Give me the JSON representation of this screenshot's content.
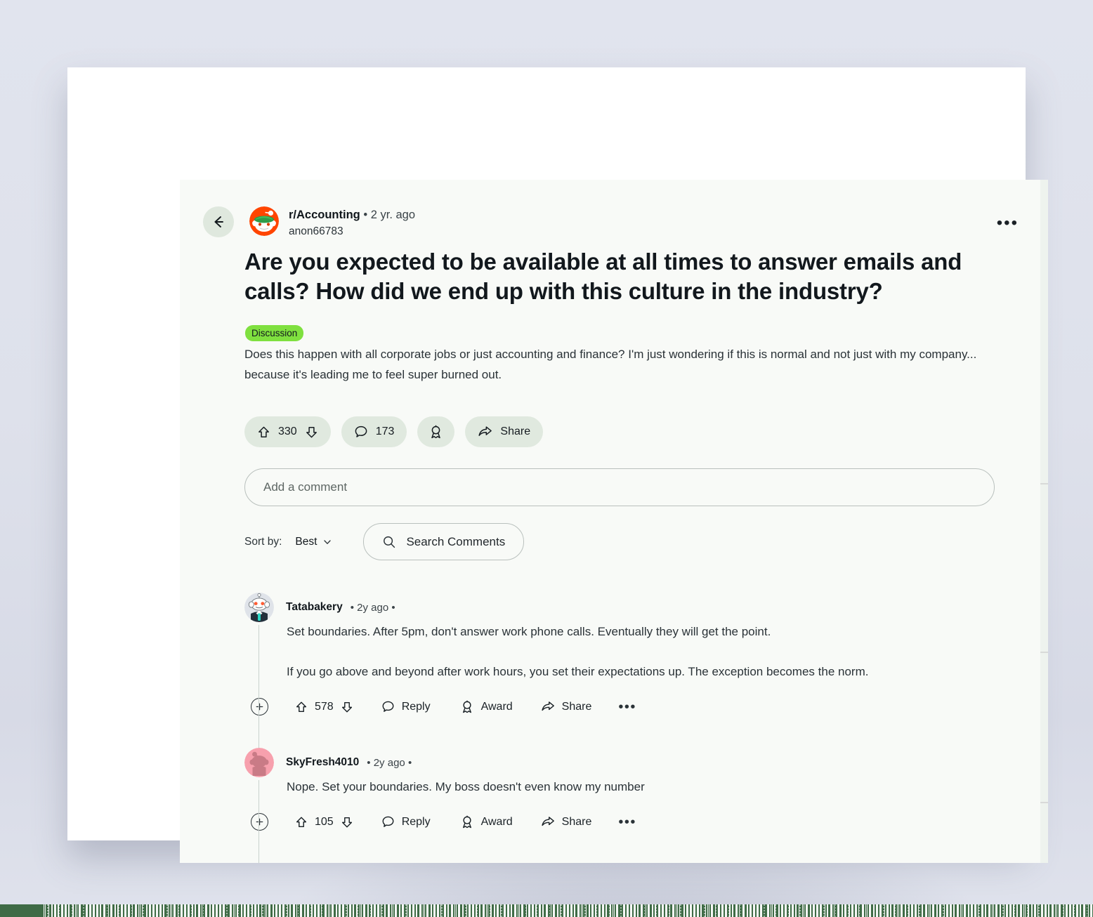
{
  "colors": {
    "page_background": "#dfe2ec",
    "card_background": "#ffffff",
    "panel_background": "#f8faf7",
    "pill_background": "#e0e9df",
    "flair_green": "#7fe03f",
    "subreddit_avatar_orange": "#ff4500",
    "bottom_strip_green": "#3f6b46",
    "text_primary": "#12181d",
    "text_secondary": "#2a3237"
  },
  "post": {
    "back_icon": "arrow-left-icon",
    "subreddit": "r/Accounting",
    "separator": "•",
    "age": "2 yr. ago",
    "author": "anon66783",
    "overflow_label": "•••",
    "title": "Are you expected to be available at all times to answer emails and calls? How did we end up with this culture in the industry?",
    "flair": "Discussion",
    "body": "Does this happen with all corporate jobs or just accounting and finance? I'm just wondering if this is normal and not just with my company... because it's leading me to feel super burned out.",
    "actions": {
      "upvote_icon": "upvote-arrow-icon",
      "score": "330",
      "downvote_icon": "downvote-arrow-icon",
      "comment_icon": "comment-bubble-icon",
      "comment_count": "173",
      "award_icon": "award-icon",
      "share_icon": "share-arrow-icon",
      "share_label": "Share"
    }
  },
  "compose": {
    "placeholder": "Add a comment"
  },
  "sort": {
    "label": "Sort by:",
    "value": "Best",
    "chevron_icon": "chevron-down-icon",
    "search_icon": "search-icon",
    "search_placeholder": "Search Comments"
  },
  "comments": [
    {
      "author": "Tatabakery",
      "separator_left": "•",
      "age": "2y ago",
      "separator_right": "•",
      "avatar": "snoo-suit-avatar",
      "paragraphs": [
        "Set boundaries. After 5pm, don't answer work phone calls. Eventually they will get the point.",
        "If you go above and beyond after work hours, you set their expectations up. The exception becomes the norm."
      ],
      "actions": {
        "expand_icon": "plus-circle-icon",
        "upvote_icon": "upvote-arrow-icon",
        "score": "578",
        "downvote_icon": "downvote-arrow-icon",
        "reply_icon": "comment-bubble-icon",
        "reply_label": "Reply",
        "award_icon": "award-icon",
        "award_label": "Award",
        "share_icon": "share-arrow-icon",
        "share_label": "Share",
        "more_label": "•••"
      }
    },
    {
      "author": "SkyFresh4010",
      "separator_left": "•",
      "age": "2y ago",
      "separator_right": "•",
      "avatar": "snoo-pink-avatar",
      "paragraphs": [
        "Nope. Set your boundaries. My boss doesn't even know my number"
      ],
      "actions": {
        "expand_icon": "plus-circle-icon",
        "upvote_icon": "upvote-arrow-icon",
        "score": "105",
        "downvote_icon": "downvote-arrow-icon",
        "reply_icon": "comment-bubble-icon",
        "reply_label": "Reply",
        "award_icon": "award-icon",
        "award_label": "Award",
        "share_icon": "share-arrow-icon",
        "share_label": "Share",
        "more_label": "•••"
      }
    }
  ]
}
